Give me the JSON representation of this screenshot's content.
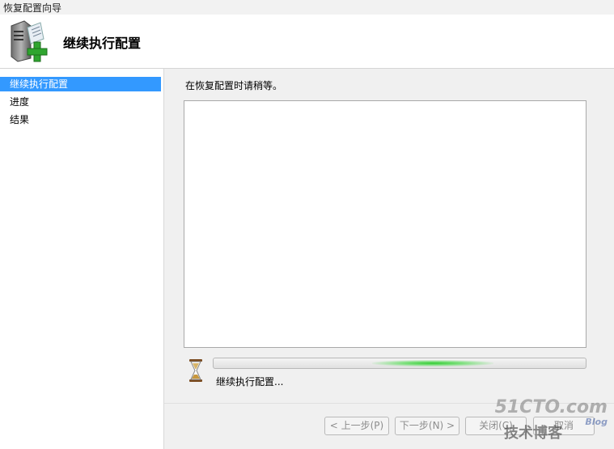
{
  "window": {
    "title": "恢复配置向导"
  },
  "header": {
    "title": "继续执行配置",
    "icon": "server-plus-icon"
  },
  "sidebar": {
    "items": [
      {
        "label": "继续执行配置",
        "active": true
      },
      {
        "label": "进度",
        "active": false
      },
      {
        "label": "结果",
        "active": false
      }
    ]
  },
  "main": {
    "instruction": "在恢复配置时请稍等。",
    "log_text": "",
    "progress_status": "继续执行配置...",
    "progress_indeterminate": true
  },
  "buttons": {
    "back": "< 上一步(P)",
    "next": "下一步(N) >",
    "close": "关闭(C)",
    "cancel": "取消"
  },
  "watermark": {
    "line1": "51CTO.com",
    "line2": "技术博客",
    "line3": "Blog"
  },
  "colors": {
    "selection": "#3399ff",
    "progress_glow": "#33cc33"
  }
}
